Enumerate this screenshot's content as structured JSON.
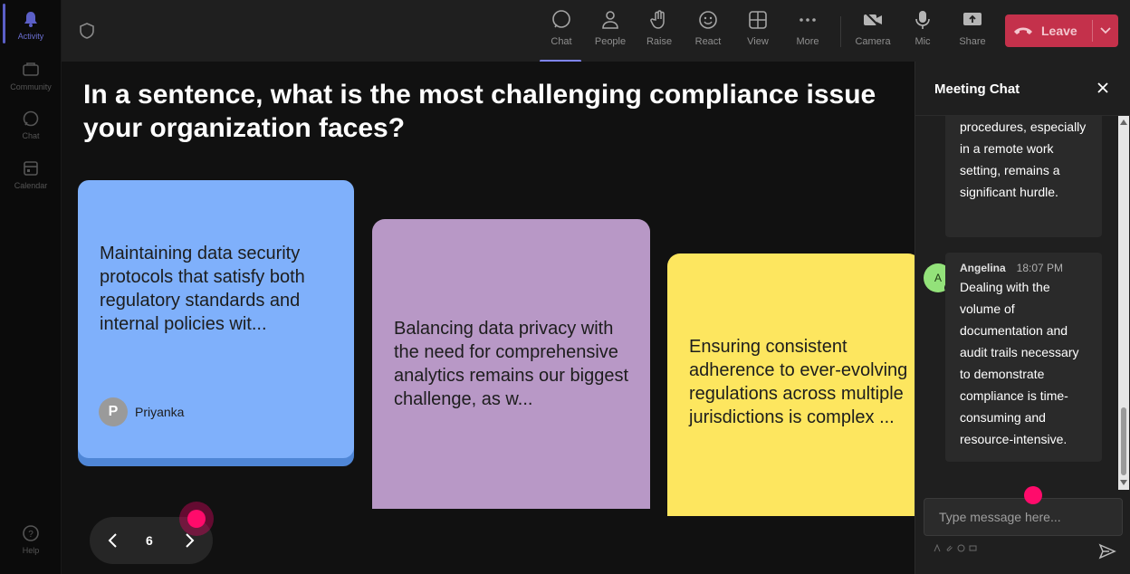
{
  "rail": {
    "items": [
      {
        "label": "Activity",
        "icon": "bell-icon",
        "active": true
      },
      {
        "label": "Community",
        "icon": "community-icon"
      },
      {
        "label": "Chat",
        "icon": "chat-icon"
      },
      {
        "label": "Calendar",
        "icon": "calendar-icon"
      },
      {
        "label": "Help",
        "icon": "help-icon"
      }
    ]
  },
  "toolbar": {
    "chat": "Chat",
    "people": "People",
    "raise": "Raise",
    "react": "React",
    "view": "View",
    "more": "More",
    "camera": "Camera",
    "mic": "Mic",
    "share": "Share",
    "leave": "Leave"
  },
  "stage": {
    "question": "In a sentence, what is the most challenging compliance issue your organization faces?",
    "cards": [
      {
        "text": "Maintaining data security protocols that satisfy both regulatory standards and internal policies wit...",
        "author_initial": "P",
        "author_name": "Priyanka",
        "color": "#7fb0fb"
      },
      {
        "text": "Balancing data privacy with the need for comprehensive analytics remains our biggest challenge, as w...",
        "color": "#b898c6"
      },
      {
        "text": "Ensuring consistent adherence to ever-evolving regulations across multiple jurisdictions is complex ...",
        "color": "#fde65f"
      }
    ],
    "page_number": "6"
  },
  "chat": {
    "title": "Meeting Chat",
    "messages": [
      {
        "text": "procedures, especially in a remote work setting, remains a significant hurdle."
      },
      {
        "sender": "Angelina",
        "initial": "A",
        "time": "18:07 PM",
        "text": "Dealing with the volume of documentation and audit trails necessary to demonstrate compliance is time-consuming and resource-intensive."
      }
    ],
    "input_placeholder": "Type message here..."
  },
  "colors": {
    "accent": "#7f85f5",
    "leave": "#c4314b",
    "cursor": "#ff0b6b"
  }
}
